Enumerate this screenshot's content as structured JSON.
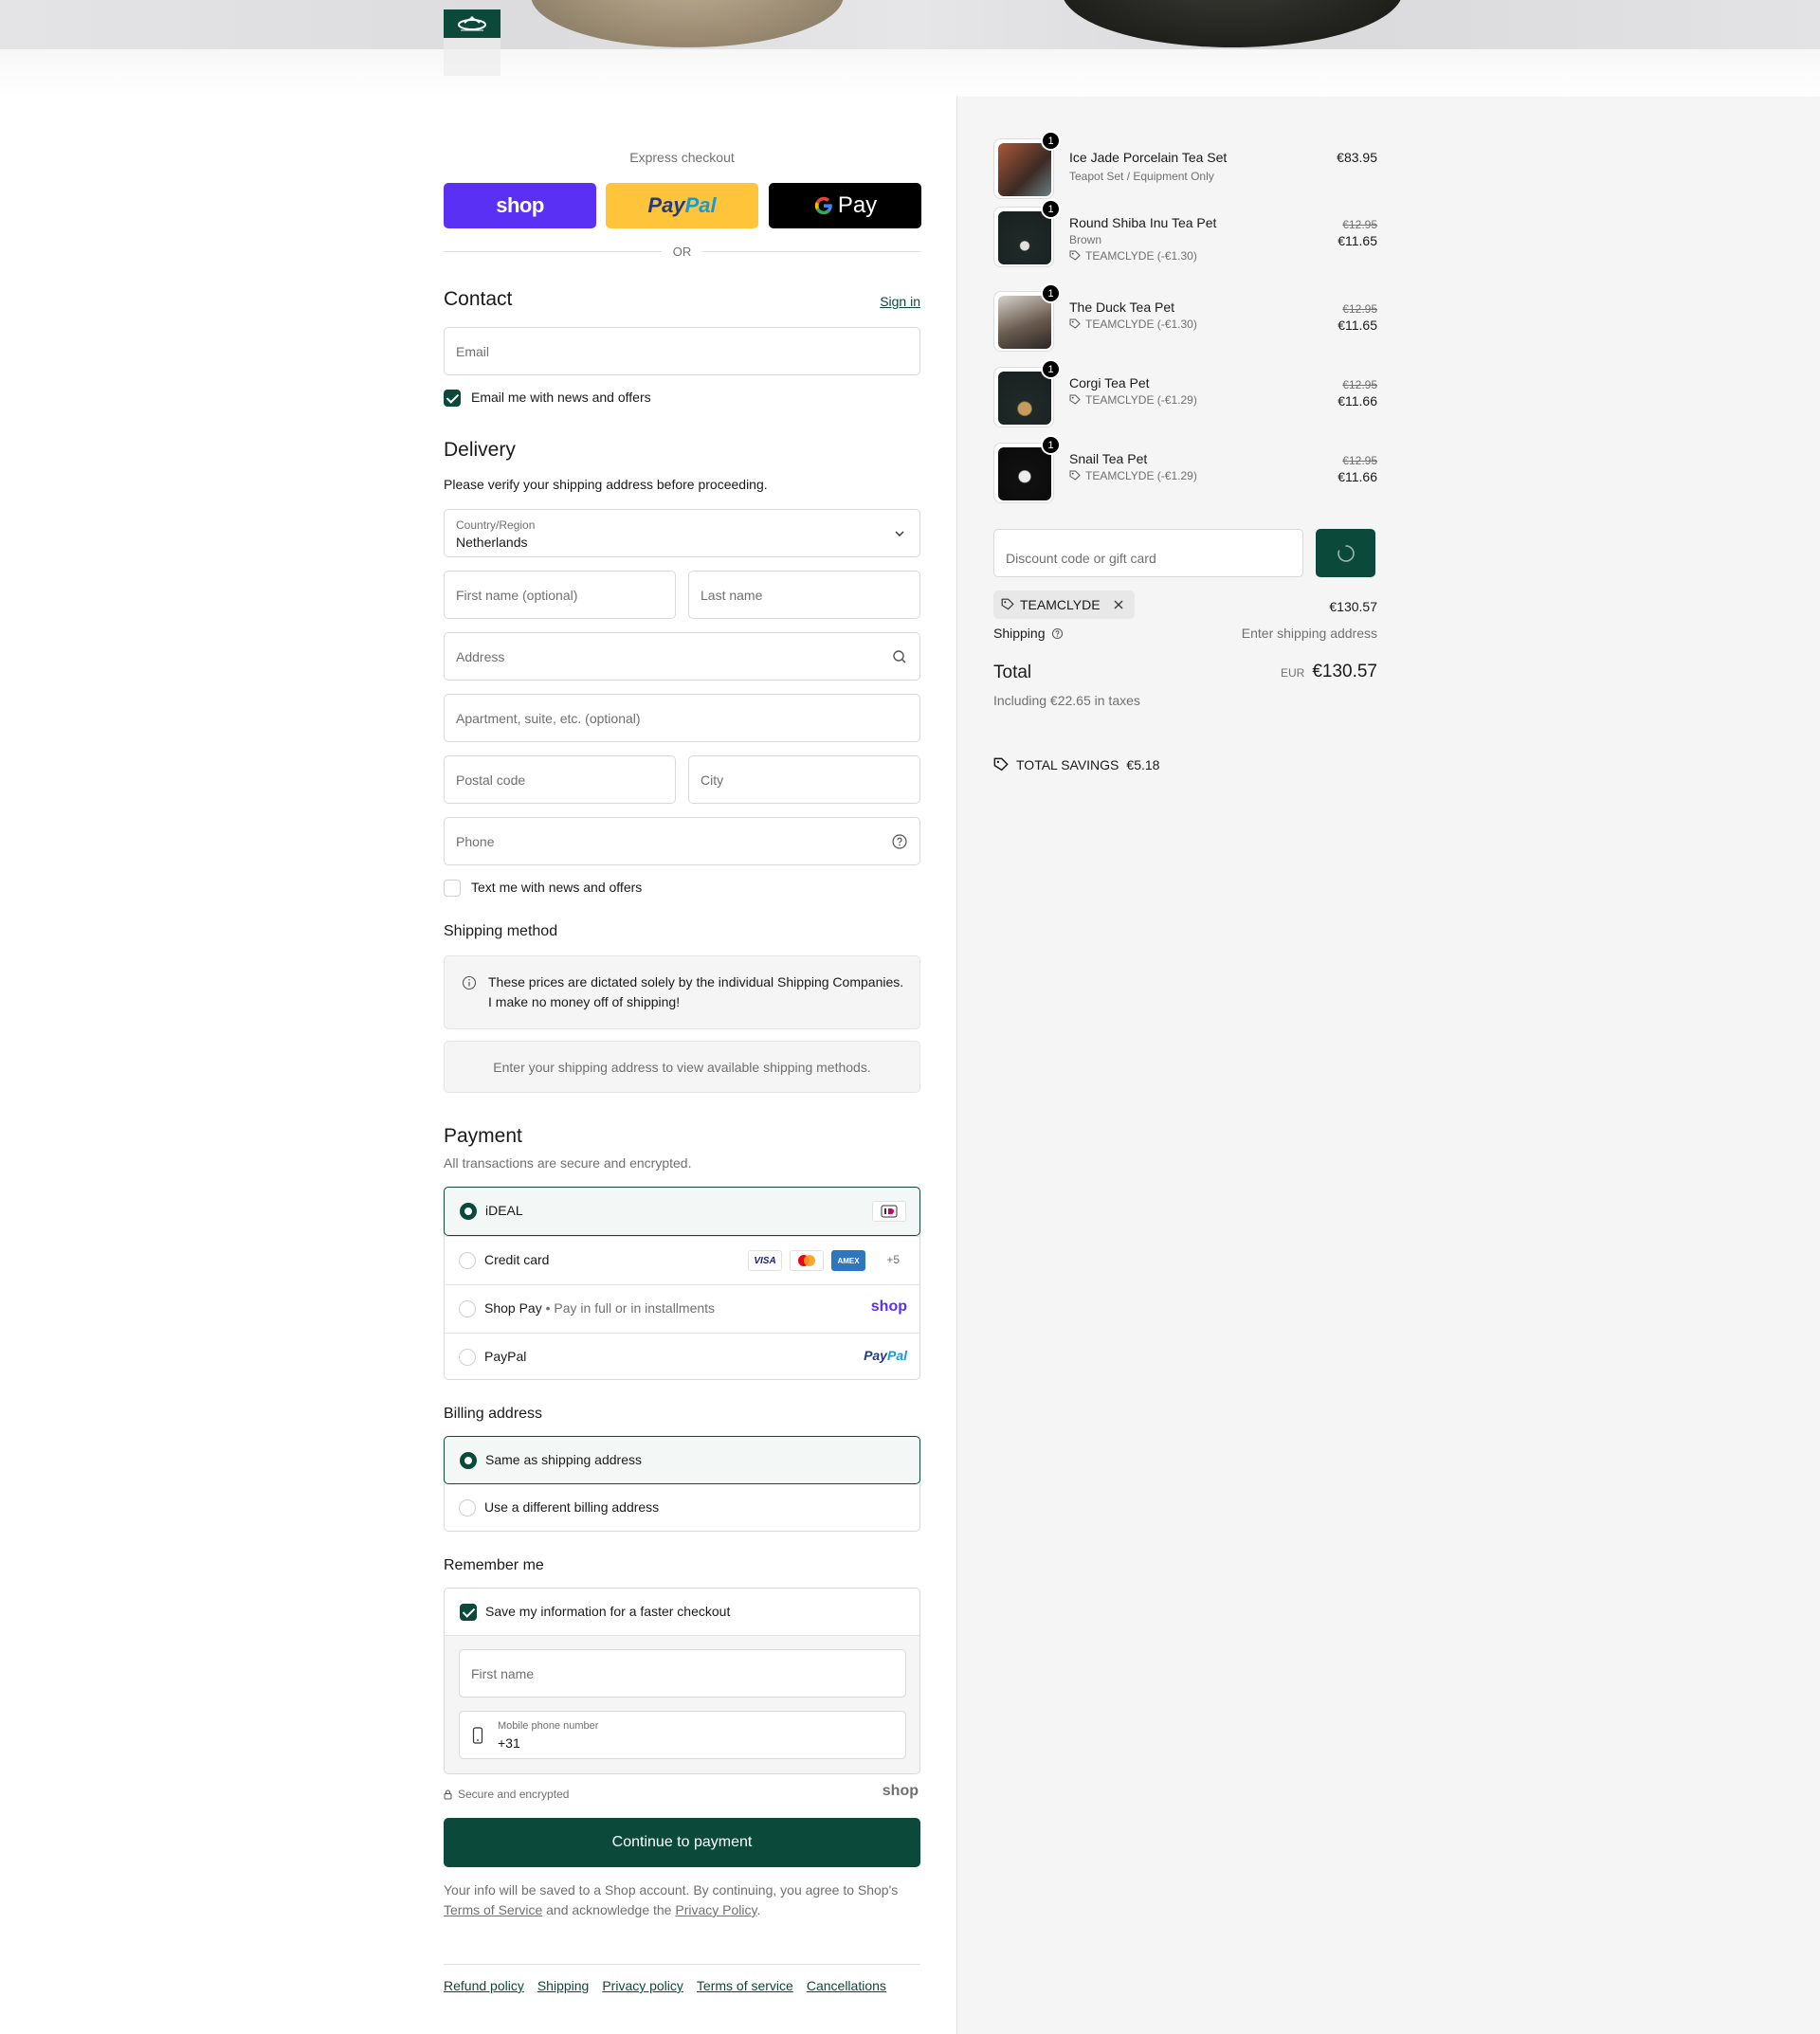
{
  "express": {
    "title": "Express checkout",
    "shop_label": "shop",
    "paypal_label_1": "Pay",
    "paypal_label_2": "Pal",
    "gpay_label": "Pay",
    "or_label": "OR"
  },
  "contact": {
    "heading": "Contact",
    "sign_in": "Sign in",
    "email_placeholder": "Email",
    "newsletter_label": "Email me with news and offers"
  },
  "delivery": {
    "heading": "Delivery",
    "notice": "Please verify your shipping address before proceeding.",
    "country_label": "Country/Region",
    "country_value": "Netherlands",
    "first_name_placeholder": "First name (optional)",
    "last_name_placeholder": "Last name",
    "address_placeholder": "Address",
    "apartment_placeholder": "Apartment, suite, etc. (optional)",
    "postal_placeholder": "Postal code",
    "city_placeholder": "City",
    "phone_placeholder": "Phone",
    "sms_label": "Text me with news and offers"
  },
  "shipping_method": {
    "heading": "Shipping method",
    "info": "These prices are dictated solely by the individual Shipping Companies. I make no money off of shipping!",
    "empty": "Enter your shipping address to view available shipping methods."
  },
  "payment": {
    "heading": "Payment",
    "subheading": "All transactions are secure and encrypted.",
    "options": [
      {
        "label": "iDEAL",
        "selected": true
      },
      {
        "label": "Credit card",
        "selected": false,
        "extra": "+5"
      },
      {
        "label": "Shop Pay",
        "selected": false,
        "note": "Pay in full or in installments",
        "logo": "shop"
      },
      {
        "label": "PayPal",
        "selected": false
      }
    ],
    "card_logos": [
      "VISA",
      "AMEX"
    ]
  },
  "billing": {
    "heading": "Billing address",
    "options": [
      {
        "label": "Same as shipping address",
        "selected": true
      },
      {
        "label": "Use a different billing address",
        "selected": false
      }
    ]
  },
  "remember": {
    "heading": "Remember me",
    "save_label": "Save my information for a faster checkout",
    "first_name_placeholder": "First name",
    "phone_label": "Mobile phone number",
    "phone_value": "+31",
    "secure_label": "Secure and encrypted",
    "shop_label": "shop"
  },
  "continue_label": "Continue to payment",
  "legal": {
    "text_1": "Your info will be saved to a Shop account. By continuing, you agree to Shop's",
    "terms": "Terms of Service",
    "text_2": "and acknowledge the",
    "privacy": "Privacy Policy",
    "text_3": "."
  },
  "footer_links": [
    "Refund policy",
    "Shipping",
    "Privacy policy",
    "Terms of service",
    "Cancellations"
  ],
  "cart": {
    "items": [
      {
        "name": "Ice Jade Porcelain Tea Set",
        "variant": "Teapot Set / Equipment Only",
        "qty": "1",
        "price": "€83.95"
      },
      {
        "name": "Round Shiba Inu Tea Pet",
        "variant": "Brown",
        "qty": "1",
        "old_price": "€12.95",
        "price": "€11.65",
        "discount": "TEAMCLYDE (-€1.30)"
      },
      {
        "name": "The Duck Tea Pet",
        "qty": "1",
        "old_price": "€12.95",
        "price": "€11.65",
        "discount": "TEAMCLYDE (-€1.30)"
      },
      {
        "name": "Corgi Tea Pet",
        "qty": "1",
        "old_price": "€12.95",
        "price": "€11.66",
        "discount": "TEAMCLYDE (-€1.29)"
      },
      {
        "name": "Snail Tea Pet",
        "qty": "1",
        "old_price": "€12.95",
        "price": "€11.66",
        "discount": "TEAMCLYDE (-€1.29)"
      }
    ],
    "discount_placeholder": "Discount code or gift card",
    "applied_code": "TEAMCLYDE",
    "subtotal": "€130.57",
    "shipping_label": "Shipping",
    "shipping_value": "Enter shipping address",
    "total_label": "Total",
    "currency": "EUR",
    "total_value": "€130.57",
    "taxes": "Including €22.65 in taxes",
    "savings_label": "TOTAL SAVINGS",
    "savings_value": "€5.18"
  },
  "colors": {
    "accent": "#0b4a3b",
    "shop": "#5a31f4",
    "paypal": "#ffc439"
  }
}
